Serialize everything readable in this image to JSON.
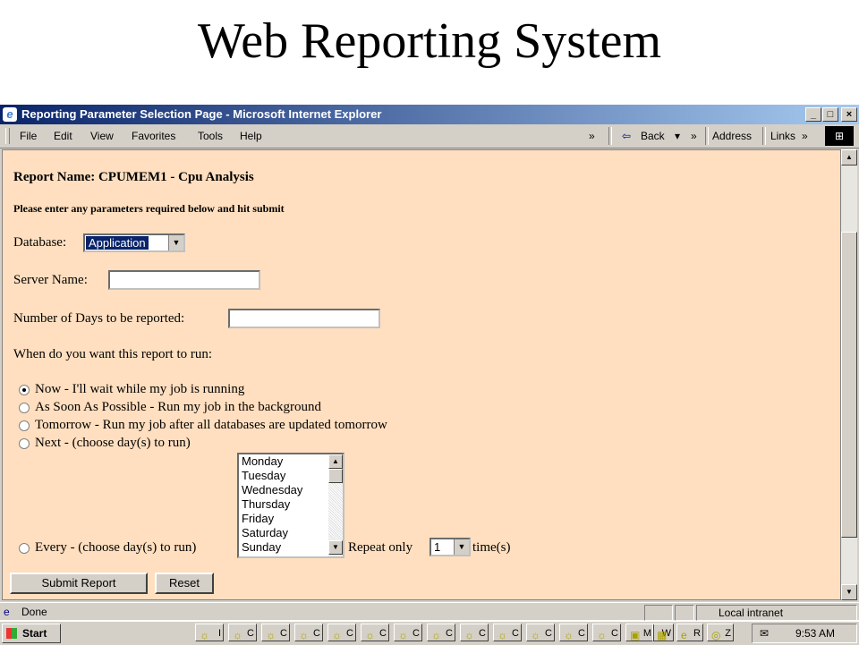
{
  "slide": {
    "title": "Web Reporting System"
  },
  "window": {
    "title": "Reporting Parameter Selection Page - Microsoft Internet Explorer",
    "controls": {
      "minimize": "_",
      "maximize": "□",
      "close": "×"
    }
  },
  "menu": {
    "items": [
      "File",
      "Edit",
      "View",
      "Favorites",
      "Tools",
      "Help"
    ],
    "chevron": "»",
    "back": "Back",
    "back_arrow": "⇦",
    "back_dropdown": "▾",
    "address": "Address",
    "links": "Links",
    "links_chevron": "»"
  },
  "form": {
    "report_name": "Report Name: CPUMEM1 - Cpu Analysis",
    "instructions": "Please enter any parameters required below and hit submit",
    "database_label": "Database:",
    "database_value": "Application",
    "server_label": "Server Name:",
    "server_value": "",
    "days_label": "Number of Days to be reported:",
    "days_value": "",
    "when_label": "When do you want this report to run:",
    "options": [
      {
        "label": "Now - I'll wait while my job is running",
        "checked": true
      },
      {
        "label": "As Soon As Possible - Run my job in the background",
        "checked": false
      },
      {
        "label": "Tomorrow - Run my job after all databases are updated tomorrow",
        "checked": false
      },
      {
        "label": "Next - (choose day(s) to run)",
        "checked": false
      },
      {
        "label": "Every - (choose day(s) to run)",
        "checked": false
      }
    ],
    "days_list": [
      "Monday",
      "Tuesday",
      "Wednesday",
      "Thursday",
      "Friday",
      "Saturday",
      "Sunday"
    ],
    "repeat_label": "Repeat only",
    "repeat_value": "1",
    "times_label": "time(s)",
    "submit_label": "Submit Report",
    "reset_label": "Reset"
  },
  "status": {
    "left": "Done",
    "zone": "Local intranet"
  },
  "taskbar": {
    "start": "Start",
    "items": [
      "I",
      "C",
      "C",
      "C",
      "C",
      "C",
      "C",
      "C",
      "C",
      "C",
      "C",
      "C",
      "C",
      "M",
      "W",
      "R",
      "Z"
    ],
    "clock": "9:53 AM"
  },
  "icons": [
    "ie-icon",
    "back-arrow-icon",
    "windows-flag-icon",
    "radio-icon",
    "dropdown-arrow-icon",
    "scroll-up-icon",
    "scroll-down-icon",
    "mail-icon"
  ]
}
